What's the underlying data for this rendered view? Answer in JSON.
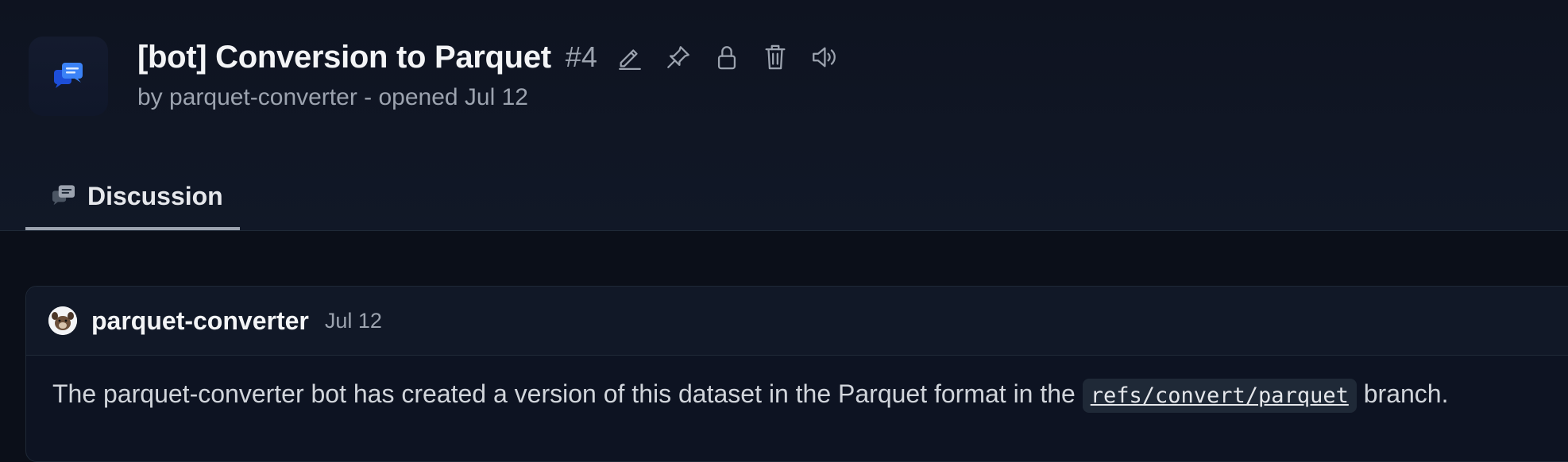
{
  "discussion": {
    "title": "[bot] Conversion to Parquet",
    "number": "#4",
    "subtitle": "by parquet-converter - opened Jul 12"
  },
  "actions": [
    {
      "icon": "edit-icon"
    },
    {
      "icon": "pin-icon"
    },
    {
      "icon": "lock-icon"
    },
    {
      "icon": "trash-icon"
    },
    {
      "icon": "announce-icon"
    }
  ],
  "tabs": [
    {
      "label": "Discussion",
      "icon": "discussion-icon",
      "active": true
    }
  ],
  "comment": {
    "author": "parquet-converter",
    "date": "Jul 12",
    "text_before": "The parquet-converter bot has created a version of this dataset in the Parquet format in the ",
    "code": "refs/convert/parquet",
    "text_after": " branch."
  },
  "colors": {
    "background": "#0b0f19",
    "accent": "#3b82f6",
    "muted": "#9ca3af"
  }
}
